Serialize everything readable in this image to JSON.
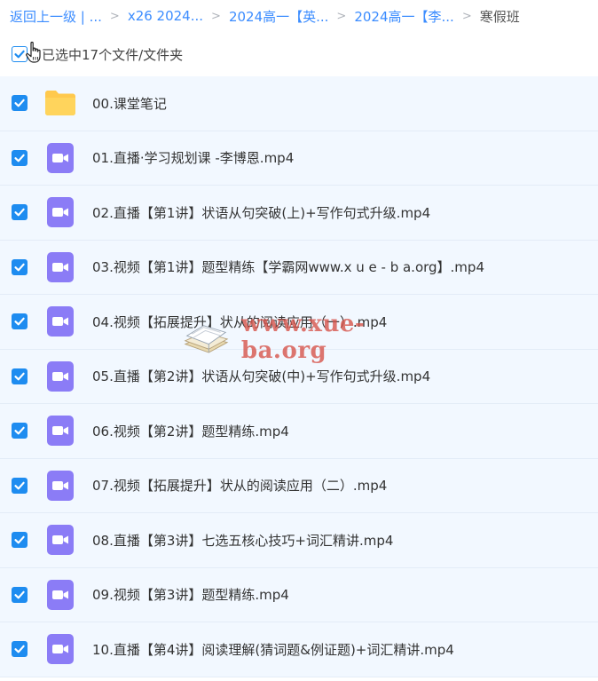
{
  "breadcrumb": {
    "items": [
      "返回上一级 | ...",
      "x26 2024...",
      "2024高一【英...",
      "2024高一【李..."
    ],
    "current": "寒假班",
    "separator": ">"
  },
  "selection": {
    "text": "已选中17个文件/文件夹",
    "checked": true
  },
  "files": [
    {
      "name": "00.课堂笔记",
      "type": "folder-icon",
      "checked": true
    },
    {
      "name": "01.直播·学习规划课 -李博恩.mp4",
      "type": "video-icon",
      "checked": true
    },
    {
      "name": "02.直播【第1讲】状语从句突破(上)+写作句式升级.mp4",
      "type": "video-icon",
      "checked": true
    },
    {
      "name": "03.视频【第1讲】题型精练【学霸网www.x u e - b a.org】.mp4",
      "type": "video-icon",
      "checked": true
    },
    {
      "name": "04.视频【拓展提升】状从的阅读应用（一）.mp4",
      "type": "video-icon",
      "checked": true
    },
    {
      "name": "05.直播【第2讲】状语从句突破(中)+写作句式升级.mp4",
      "type": "video-icon",
      "checked": true
    },
    {
      "name": "06.视频【第2讲】题型精练.mp4",
      "type": "video-icon",
      "checked": true
    },
    {
      "name": "07.视频【拓展提升】状从的阅读应用（二）.mp4",
      "type": "video-icon",
      "checked": true
    },
    {
      "name": "08.直播【第3讲】七选五核心技巧+词汇精讲.mp4",
      "type": "video-icon",
      "checked": true
    },
    {
      "name": "09.视频【第3讲】题型精练.mp4",
      "type": "video-icon",
      "checked": true
    },
    {
      "name": "10.直播【第4讲】阅读理解(猜词题&例证题)+词汇精讲.mp4",
      "type": "video-icon",
      "checked": true
    }
  ],
  "watermark": {
    "text": "www.xue-ba.org"
  },
  "colors": {
    "accent": "#1e8cf0",
    "link": "#3b8cff",
    "row_bg": "#f2f8ff",
    "video_icon": "#8b7cf6",
    "folder_icon": "#ffc94d"
  }
}
